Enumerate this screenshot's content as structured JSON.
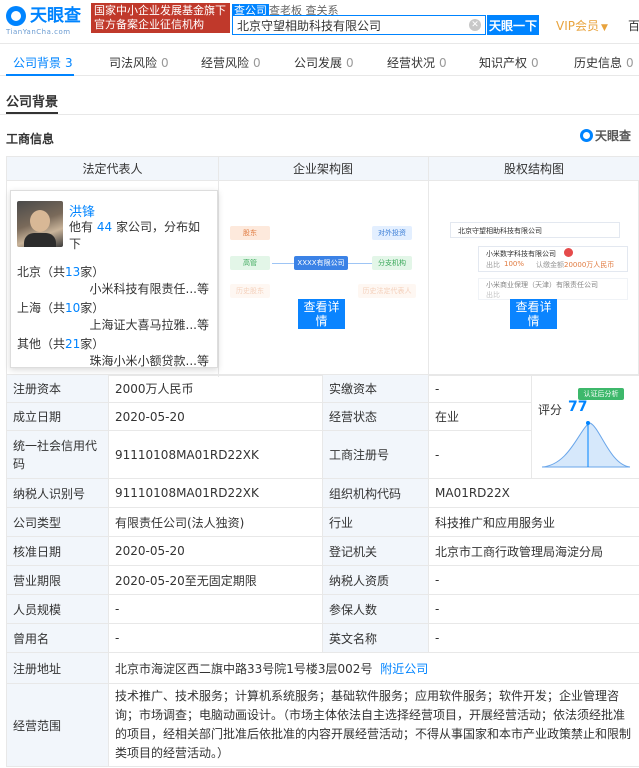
{
  "header": {
    "logo_text": "天眼查",
    "logo_sub": "TianYanCha.com",
    "banner_text": "国家中小企业发展基金旗下 官方备案企业征信机构",
    "search_tabs": [
      "查公司",
      "查老板",
      "查关系"
    ],
    "search_value": "北京守望相助科技有限公司",
    "search_button": "天眼一下",
    "vip_label": "VIP会员",
    "cut_text": "百"
  },
  "tabs": [
    {
      "label": "公司背景",
      "count": "3"
    },
    {
      "label": "司法风险",
      "count": "0"
    },
    {
      "label": "经营风险",
      "count": "0"
    },
    {
      "label": "公司发展",
      "count": "0"
    },
    {
      "label": "经营状况",
      "count": "0"
    },
    {
      "label": "知识产权",
      "count": "0"
    },
    {
      "label": "历史信息",
      "count": "0"
    }
  ],
  "section_title": "公司背景",
  "sub_title": "工商信息",
  "brand_mark": "天眼查",
  "panel": {
    "col1": "法定代表人",
    "col2": "企业架构图",
    "col3": "股权结构图"
  },
  "legal_rep": {
    "name": "洪锋",
    "desc_prefix": "他有",
    "count": "44",
    "desc_suffix": "家公司，分布如下",
    "regions": [
      {
        "prefix": "北京（共",
        "count": "13",
        "suffix": "家）",
        "company": "小米科技有限责任...等"
      },
      {
        "prefix": "上海（共",
        "count": "10",
        "suffix": "家）",
        "company": "上海证大喜马拉雅...等"
      },
      {
        "prefix": "其他（共",
        "count": "21",
        "suffix": "家）",
        "company": "珠海小米小额贷款...等"
      }
    ]
  },
  "arch_diagram": {
    "left": [
      "股东",
      "高管",
      "历史股东"
    ],
    "center": "XXXX有限公司",
    "right": [
      "对外投资",
      "分支机构",
      "历史法定代表人"
    ],
    "button": "查看详情"
  },
  "equity_diagram": {
    "root": "北京守望相助科技有限公司",
    "child1": "小米数字科技有限公司",
    "child1_ratio_label": "出比",
    "child1_ratio": "100%",
    "child1_capital_label": "认缴金额",
    "child1_capital": "20000万人民币",
    "child2": "小米商业保理（天津）有限责任公司",
    "child2_ratio_label": "出比",
    "button": "查看详情"
  },
  "score": {
    "badge": "认证后分析",
    "label": "评分",
    "value": "77"
  },
  "info_rows": [
    {
      "l1": "注册资本",
      "v1": "2000万人民币",
      "l2": "实缴资本",
      "v2": "-"
    },
    {
      "l1": "成立日期",
      "v1": "2020-05-20",
      "l2": "经营状态",
      "v2": "在业"
    },
    {
      "l1": "统一社会信用代码",
      "v1": "91110108MA01RD22XK",
      "l2": "工商注册号",
      "v2": "-"
    },
    {
      "l1": "纳税人识别号",
      "v1": "91110108MA01RD22XK",
      "l2": "组织机构代码",
      "v2": "MA01RD22X"
    },
    {
      "l1": "公司类型",
      "v1": "有限责任公司(法人独资)",
      "l2": "行业",
      "v2": "科技推广和应用服务业"
    },
    {
      "l1": "核准日期",
      "v1": "2020-05-20",
      "l2": "登记机关",
      "v2": "北京市工商行政管理局海淀分局"
    },
    {
      "l1": "营业期限",
      "v1": "2020-05-20至无固定期限",
      "l2": "纳税人资质",
      "v2": "-"
    },
    {
      "l1": "人员规模",
      "v1": "-",
      "l2": "参保人数",
      "v2": "-"
    },
    {
      "l1": "曾用名",
      "v1": "-",
      "l2": "英文名称",
      "v2": "-"
    }
  ],
  "address": {
    "label": "注册地址",
    "value": "北京市海淀区西二旗中路33号院1号楼3层002号",
    "link": "附近公司"
  },
  "scope": {
    "label": "经营范围",
    "value": "技术推广、技术服务；计算机系统服务；基础软件服务；应用软件服务；软件开发；企业管理咨询；市场调查；电脑动画设计。（市场主体依法自主选择经营项目，开展经营活动；依法须经批准的项目，经相关部门批准后依批准的内容开展经营活动；不得从事国家和本市产业政策禁止和限制类项目的经营活动。）"
  }
}
